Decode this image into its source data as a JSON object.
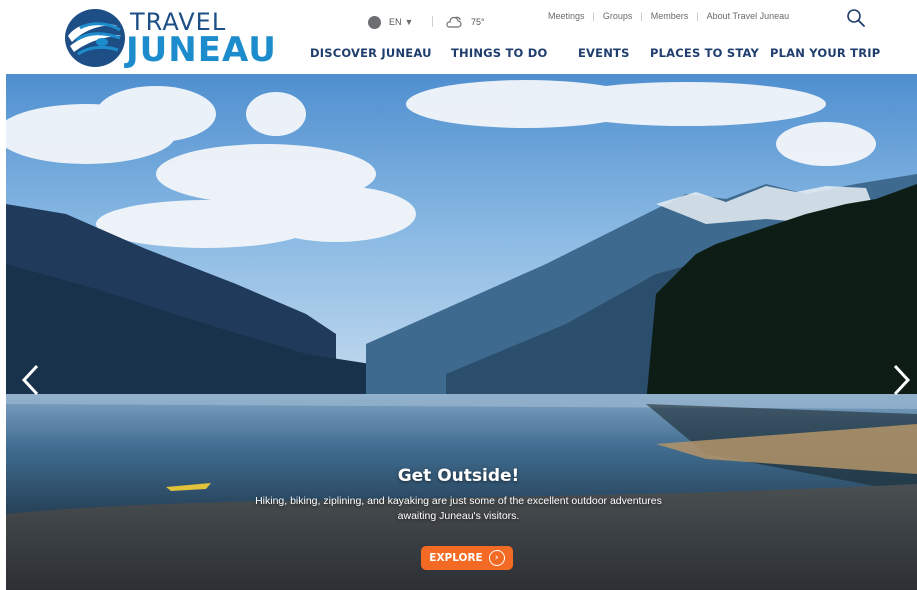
{
  "brand": {
    "line1": "TRAVEL",
    "line2": "JUNEAU",
    "icon": "travel-juneau-logo-icon",
    "colors": {
      "dark_blue": "#1d4f86",
      "light_blue": "#1d8ccc"
    }
  },
  "utility": {
    "language": "EN",
    "language_icon": "globe-icon",
    "temperature": "75°",
    "weather_icon": "cloud-sun-icon",
    "links": [
      "Meetings",
      "Groups",
      "Members",
      "About Travel Juneau"
    ],
    "search_icon": "search-icon"
  },
  "nav": {
    "items": [
      "DISCOVER JUNEAU",
      "THINGS TO DO",
      "EVENTS",
      "PLACES TO STAY",
      "PLAN YOUR TRIP"
    ],
    "color": "#1f3e6e"
  },
  "hero": {
    "title": "Get Outside!",
    "description": "Hiking, biking, ziplining, and kayaking are just some of the excellent outdoor adventures awaiting Juneau's visitors.",
    "cta": "EXPLORE",
    "cta_color": "#f26a23",
    "prev_icon": "chevron-left-icon",
    "next_icon": "chevron-right-icon"
  }
}
